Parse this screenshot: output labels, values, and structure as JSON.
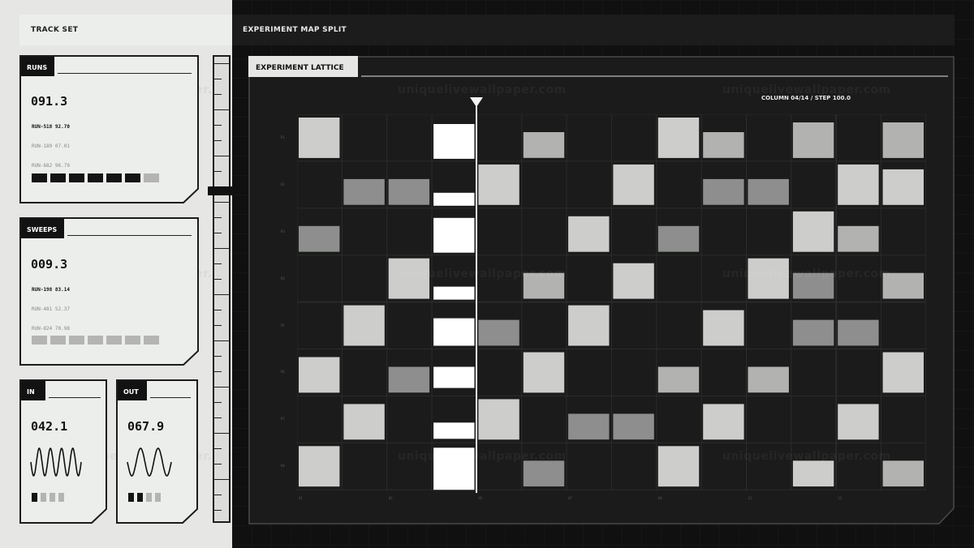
{
  "track_set": {
    "title": "TRACK SET"
  },
  "experiment_map": {
    "title": "EXPERIMENT MAP SPLIT"
  },
  "watermark": "uniquelivewallpaper.com",
  "cards": {
    "runs": {
      "label": "RUNS",
      "value": "091.3",
      "lines": [
        "RUN-518 92.70",
        "RUN-189 07.01",
        "RUN-682 96.79"
      ],
      "segments": [
        1,
        1,
        1,
        1,
        1,
        1,
        0
      ]
    },
    "sweeps": {
      "label": "SWEEPS",
      "value": "009.3",
      "lines": [
        "RUN-198 83.14",
        "RUN-481 52.37",
        "RUN-824 70.98"
      ],
      "segments": [
        0,
        0,
        0,
        0,
        0,
        0,
        0
      ]
    },
    "in": {
      "label": "IN",
      "value": "042.1",
      "segments": [
        1,
        0,
        0,
        0
      ]
    },
    "out": {
      "label": "OUT",
      "value": "067.9",
      "segments": [
        1,
        1,
        0,
        0
      ]
    }
  },
  "lattice": {
    "tab_label": "EXPERIMENT LATTICE",
    "readout": "COLUMN 04/14 / STEP 100.0",
    "row_labels": [
      "R1",
      "R2",
      "R3",
      "R4",
      "R5",
      "R6",
      "R7",
      "R8"
    ],
    "col_labels": [
      "01",
      "03",
      "05",
      "07",
      "09",
      "11",
      "13"
    ],
    "playhead_column": 4,
    "colors": {
      "background": "#1a1b1a",
      "grid": "#2b2c2b",
      "shade1": "#8d8e8d",
      "shade2": "#b2b3b1",
      "shade3": "#cdcecc",
      "bright": "#ffffff"
    }
  }
}
